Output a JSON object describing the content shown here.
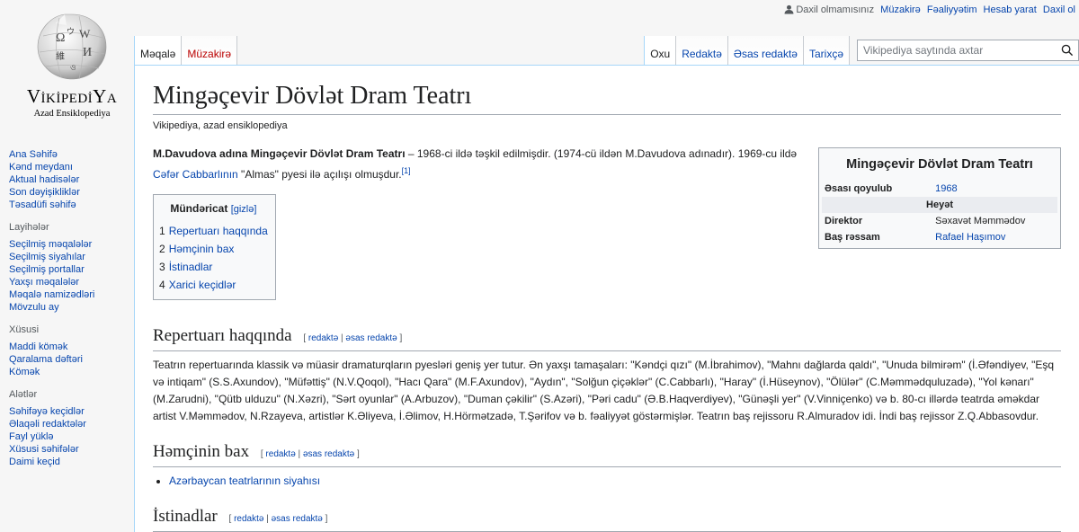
{
  "personal": {
    "not_logged_in": "Daxil olmamısınız",
    "talk": "Müzakirə",
    "contributions": "Fəaliyyətim",
    "create_account": "Hesab yarat",
    "login": "Daxil ol"
  },
  "logo": {
    "wordmark_big1": "V",
    "wordmark_small1": "İKİPEDİ",
    "wordmark_big2": "Y",
    "wordmark_small2": "A",
    "tagline": "Azad Ensiklopediya"
  },
  "sidebar": {
    "navigation": [
      "Ana Səhifə",
      "Kənd meydanı",
      "Aktual hadisələr",
      "Son dəyişikliklər",
      "Təsadüfi səhifə"
    ],
    "projects_title": "Layihələr",
    "projects": [
      "Seçilmiş məqalələr",
      "Seçilmiş siyahılar",
      "Seçilmiş portallar",
      "Yaxşı məqalələr",
      "Məqalə namizədləri",
      "Mövzulu ay"
    ],
    "special_title": "Xüsusi",
    "special": [
      "Maddi kömək",
      "Qaralama dəftəri",
      "Kömək"
    ],
    "tools_title": "Alətlər",
    "tools": [
      "Səhifəyə keçidlər",
      "Əlaqəli redaktələr",
      "Fayl yüklə",
      "Xüsusi səhifələr",
      "Daimi keçid"
    ]
  },
  "tabs": {
    "article": "Məqalə",
    "talk": "Müzakirə",
    "read": "Oxu",
    "edit": "Redaktə",
    "edit_source": "Əsas redaktə",
    "history": "Tarixçə"
  },
  "search": {
    "placeholder": "Vikipediya saytında axtar"
  },
  "article": {
    "title": "Mingəçevir Dövlət Dram Teatrı",
    "subtitle": "Vikipediya, azad ensiklopediya",
    "lead_bold": "M.Davudova adına Mingəçevir Dövlət Dram Teatrı",
    "lead_text1": " – 1968-ci ildə təşkil edilmişdir. (1974-cü ildən M.Davudova adınadır). 1969-cu ildə ",
    "lead_link": "Cəfər Cabbarlının",
    "lead_text2": " \"Almas\" pyesi ilə açılışı olmuşdur.",
    "lead_ref": "[1]"
  },
  "toc": {
    "title": "Mündəricat",
    "toggle": "[gizlə]",
    "items": [
      {
        "num": "1",
        "label": "Repertuarı haqqında"
      },
      {
        "num": "2",
        "label": "Həmçinin bax"
      },
      {
        "num": "3",
        "label": "İstinadlar"
      },
      {
        "num": "4",
        "label": "Xarici keçidlər"
      }
    ]
  },
  "infobox": {
    "title": "Mingəçevir Dövlət Dram Teatrı",
    "founded_label": "Əsası qoyulub",
    "founded_value": "1968",
    "staff_header": "Heyət",
    "director_label": "Direktor",
    "director_value": "Səxavət Məmmədov",
    "artist_label": "Baş rəssam",
    "artist_value": "Rafael Haşımov"
  },
  "sections": {
    "edit": "redaktə",
    "edit_source": "əsas redaktə",
    "repertoire_title": "Repertuarı haqqında",
    "repertoire_text": "Teatrın repertuarında klassik və müasir dramaturqların pyesləri geniş yer tutur. Ən yaxşı tamaşaları: \"Kəndçi qızı\" (M.İbrahimov), \"Mahnı dağlarda qaldı\", \"Unuda bilmirəm\" (İ.Əfəndiyev, \"Eşq və intiqam\" (S.S.Axundov), \"Müfəttiş\" (N.V.Qoqol), \"Hacı Qara\" (M.F.Axundov), \"Aydın\", \"Solğun çiçəklər\" (C.Cabbarlı), \"Haray\" (İ.Hüseynov), \"Ölülər\" (C.Məmmədquluzadə), \"Yol kənarı\" (M.Zarudni), \"Qütb ulduzu\" (N.Xəzri), \"Sərt oyunlar\" (A.Arbuzov), \"Duman çəkilir\" (S.Azəri), \"Pəri cadu\" (Ə.B.Haqverdiyev), \"Günəşli yer\" (V.Vinniçenko) və b. 80-cı illərdə teatrda əməkdar artist V.Məmmədov, N.Rzayeva, artistlər K.Əliyeva, İ.Əlimov, H.Hörmətzadə, T.Şərifov və b. fəaliyyət göstərmişlər. Teatrın baş rejissoru R.Almuradov idi. İndi baş rejissor Z.Q.Abbasovdur.",
    "see_also_title": "Həmçinin bax",
    "see_also_items": [
      "Azərbaycan teatrlarının siyahısı"
    ],
    "refs_title": "İstinadlar"
  },
  "colors": {
    "link": "#0645ad",
    "new_link": "#ba0000",
    "border": "#a7d7f9"
  }
}
